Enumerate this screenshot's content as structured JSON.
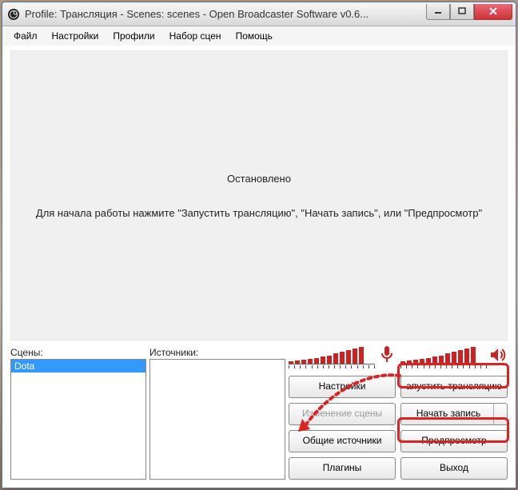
{
  "titlebar": {
    "title": "Profile: Трансляция - Scenes: scenes - Open Broadcaster Software v0.6..."
  },
  "menu": {
    "file": "Файл",
    "settings": "Настройки",
    "profiles": "Профили",
    "scene_collection": "Набор сцен",
    "help": "Помощь"
  },
  "preview": {
    "status": "Остановлено",
    "hint": "Для начала работы нажмите \"Запустить трансляцию\", \"Начать запись\", или \"Предпросмотр\""
  },
  "panels": {
    "scenes_label": "Сцены:",
    "sources_label": "Источники:",
    "scenes": [
      "Dota"
    ],
    "sources": []
  },
  "buttons": {
    "settings": "Настройки",
    "start_stream": "апустить трансляцию",
    "edit_scene": "Изменение сцены",
    "start_record": "Начать запись",
    "global_sources": "Общие источники",
    "preview": "Предпросмотр",
    "plugins": "Плагины",
    "exit": "Выход"
  },
  "icons": {
    "mic": "mic-icon",
    "speaker": "speaker-icon"
  }
}
